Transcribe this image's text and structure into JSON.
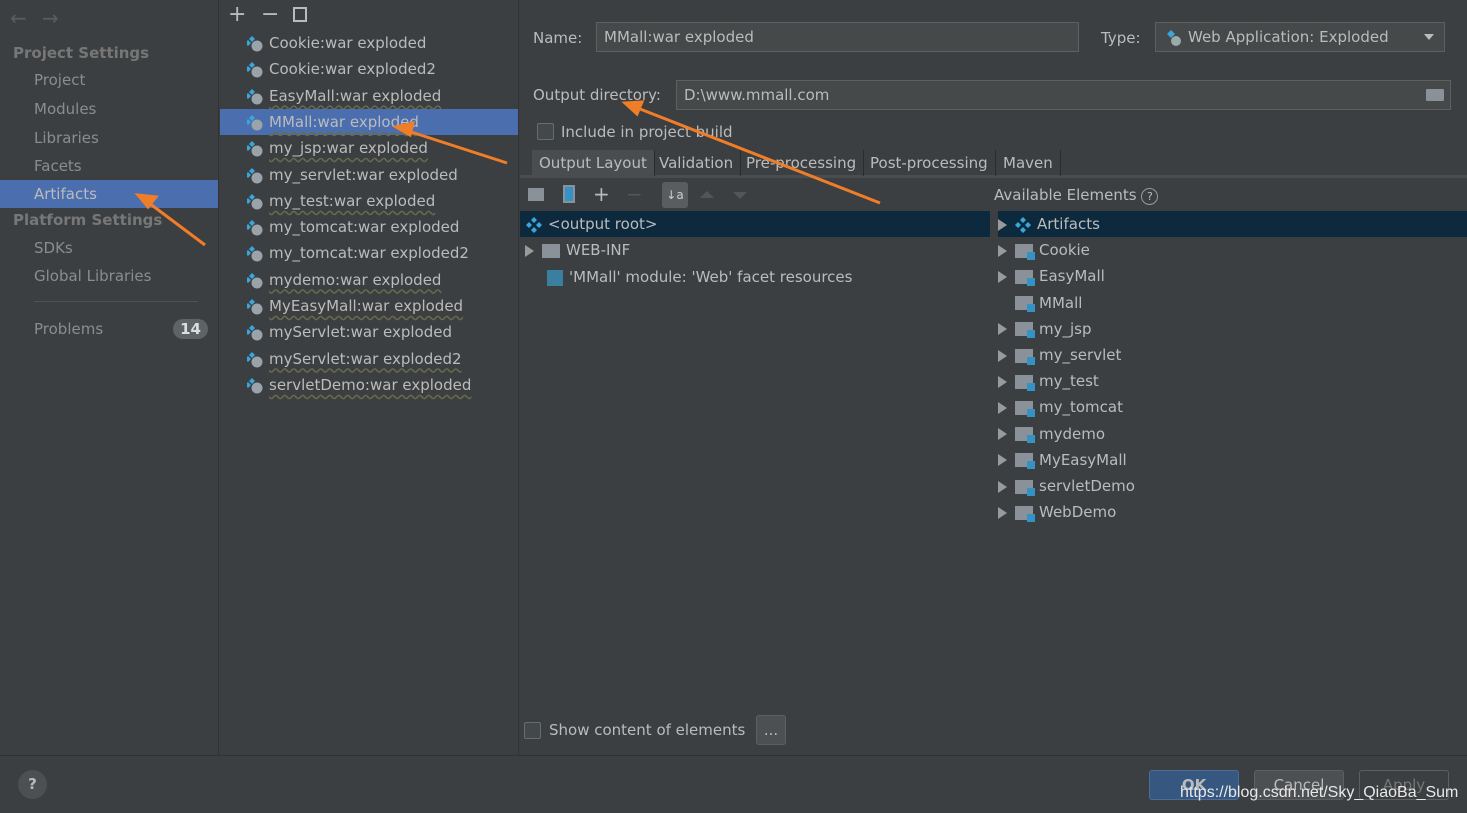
{
  "sidebar": {
    "project_settings": "Project Settings",
    "platform_settings": "Platform Settings",
    "items": [
      "Project",
      "Modules",
      "Libraries",
      "Facets",
      "Artifacts"
    ],
    "platform_items": [
      "SDKs",
      "Global Libraries"
    ],
    "problems": "Problems",
    "problems_count": "14"
  },
  "artifacts": [
    "Cookie:war exploded",
    "Cookie:war exploded2",
    "EasyMall:war exploded",
    "MMall:war exploded",
    "my_jsp:war exploded",
    "my_servlet:war exploded",
    "my_test:war exploded",
    "my_tomcat:war exploded",
    "my_tomcat:war exploded2",
    "mydemo:war exploded",
    "MyEasyMall:war exploded",
    "myServlet:war exploded",
    "myServlet:war exploded2",
    "servletDemo:war exploded"
  ],
  "form": {
    "name_label": "Name:",
    "name_value": "MMall:war exploded",
    "type_label": "Type:",
    "type_value": "Web Application: Exploded",
    "output_label": "Output directory:",
    "output_value": "D:\\www.mmall.com",
    "include_label": "Include in project build",
    "include_checked": false
  },
  "tabs": [
    "Output Layout",
    "Validation",
    "Pre-processing",
    "Post-processing",
    "Maven"
  ],
  "layout_tree": {
    "root": "<output root>",
    "webinf": "WEB-INF",
    "module": "'MMall' module: 'Web' facet resources"
  },
  "available": {
    "title": "Available Elements",
    "items": [
      "Artifacts",
      "Cookie",
      "EasyMall",
      "MMall",
      "my_jsp",
      "my_servlet",
      "my_test",
      "my_tomcat",
      "mydemo",
      "MyEasyMall",
      "servletDemo",
      "WebDemo"
    ]
  },
  "show_content": "Show content of elements",
  "ellipsis": "...",
  "buttons": {
    "ok": "OK",
    "cancel": "Cancel",
    "apply": "Apply",
    "help": "?"
  },
  "watermark": "https://blog.csdn.net/Sky_QiaoBa_Sum",
  "colors": {
    "selection": "#4b6eaf",
    "annotation_arrow": "#f07d28",
    "root_row": "#0d293e"
  }
}
